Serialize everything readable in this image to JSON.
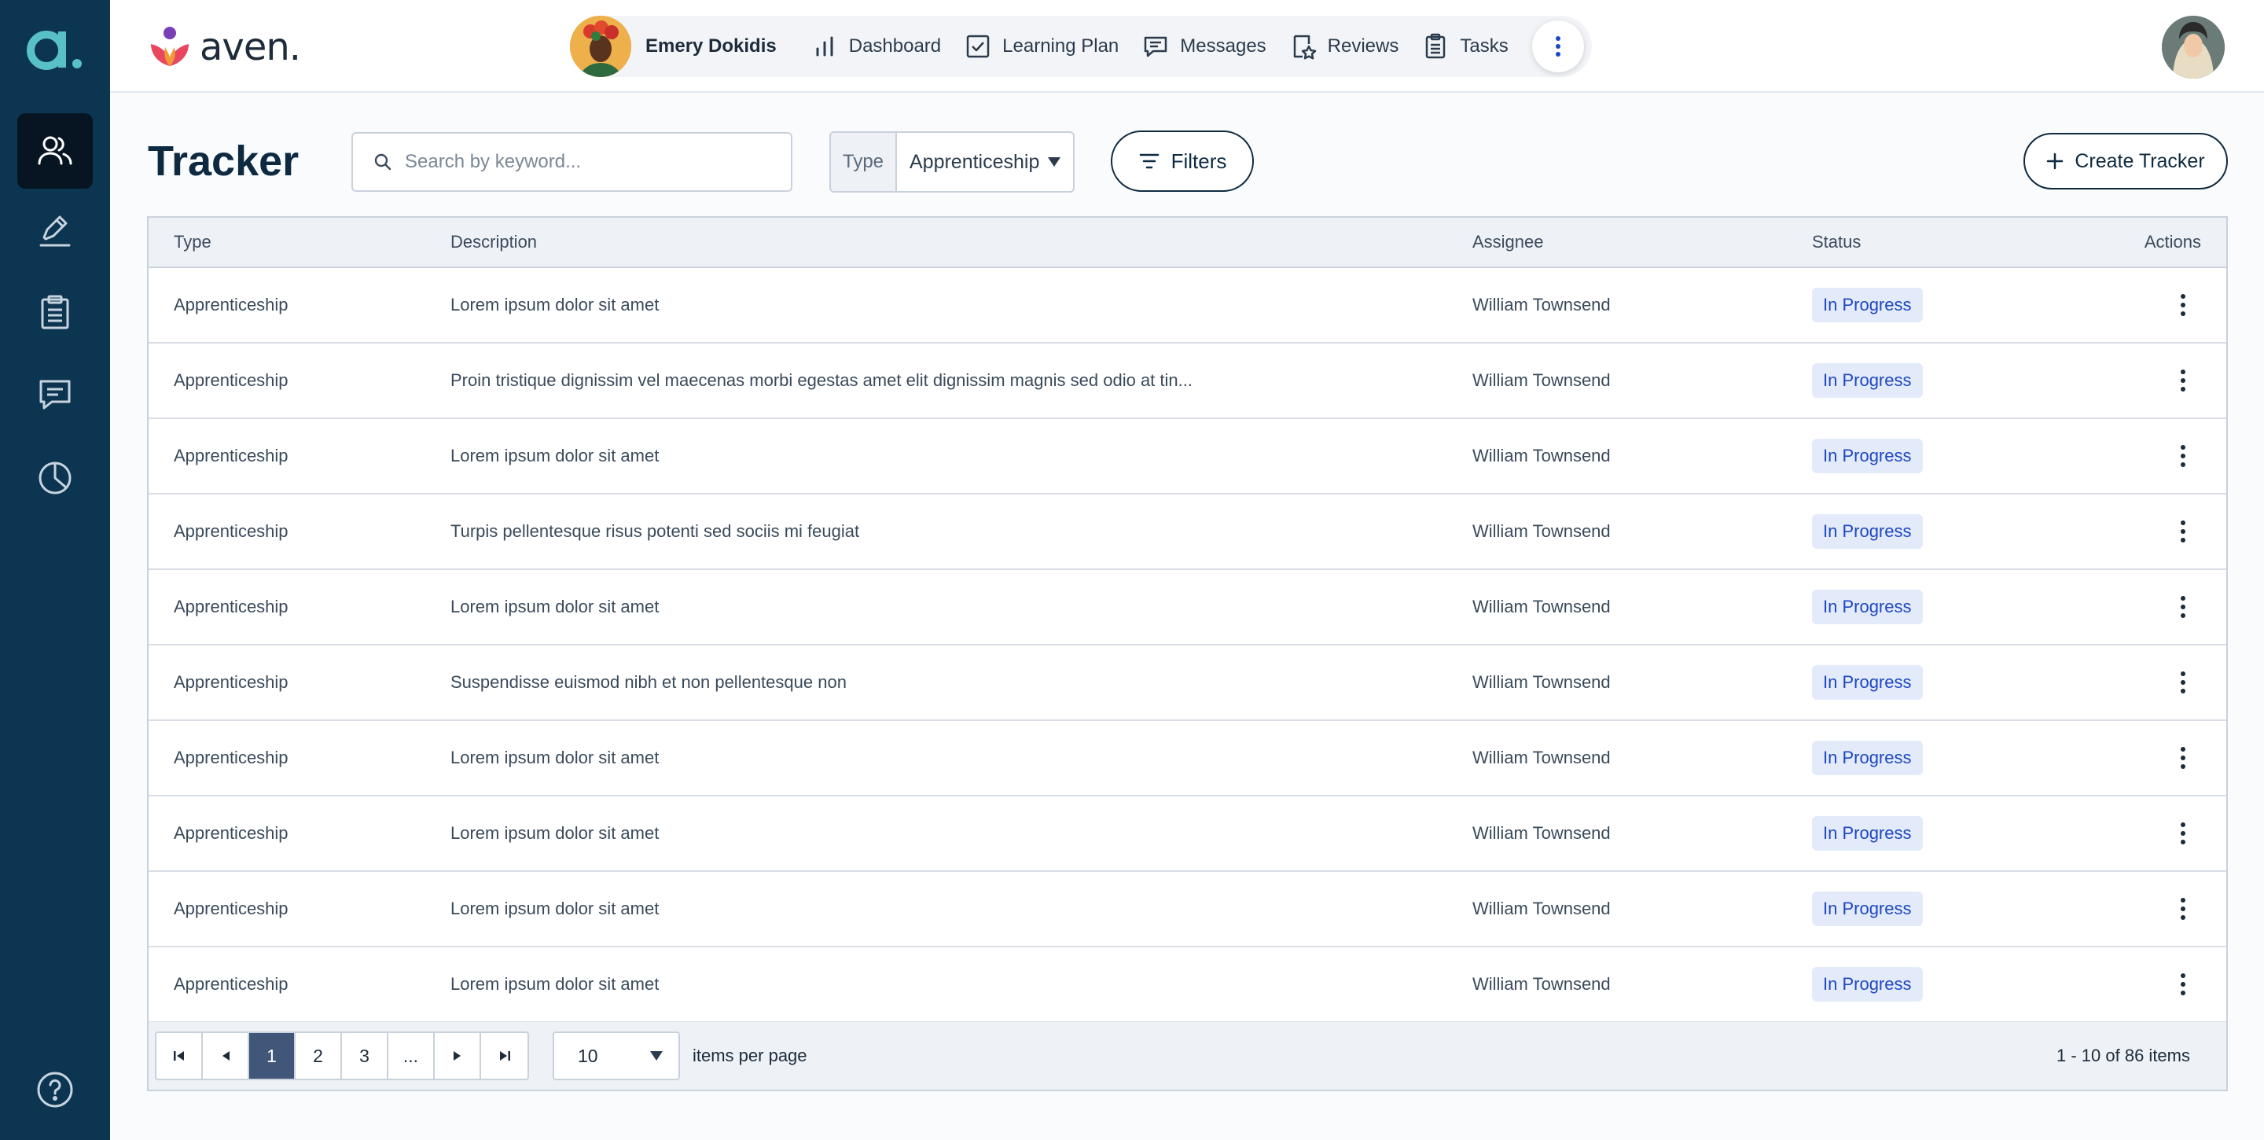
{
  "colors": {
    "rail_bg": "#0c3552",
    "rail_active": "#071522",
    "accent_teal": "#58c0c8",
    "badge_bg": "#e3ebfb",
    "badge_text": "#1e47c2",
    "pager_active": "#41577a"
  },
  "rail": {
    "logo": "a.",
    "items": [
      {
        "icon": "users-icon",
        "active": true
      },
      {
        "icon": "pen-icon",
        "active": false
      },
      {
        "icon": "clipboard-icon",
        "active": false
      },
      {
        "icon": "chat-icon",
        "active": false
      },
      {
        "icon": "pie-chart-icon",
        "active": false
      }
    ],
    "help_icon": "help-icon"
  },
  "brand": {
    "name": "aven."
  },
  "topnav": {
    "profile_name": "Emery Dokidis",
    "items": [
      {
        "label": "Dashboard",
        "icon": "bar-chart-icon"
      },
      {
        "label": "Learning Plan",
        "icon": "checkbox-icon"
      },
      {
        "label": "Messages",
        "icon": "message-icon"
      },
      {
        "label": "Reviews",
        "icon": "review-icon"
      },
      {
        "label": "Tasks",
        "icon": "tasks-icon"
      }
    ],
    "more_icon": "more-vertical-icon"
  },
  "page": {
    "title": "Tracker",
    "search_placeholder": "Search by keyword...",
    "type_label": "Type",
    "type_value": "Apprenticeship",
    "filters_label": "Filters",
    "create_label": "Create Tracker"
  },
  "table": {
    "headers": {
      "type": "Type",
      "description": "Description",
      "assignee": "Assignee",
      "status": "Status",
      "actions": "Actions"
    },
    "rows": [
      {
        "type": "Apprenticeship",
        "description": "Lorem ipsum dolor sit amet",
        "assignee": "William Townsend",
        "status": "In Progress"
      },
      {
        "type": "Apprenticeship",
        "description": "Proin tristique dignissim vel maecenas morbi egestas amet elit dignissim magnis sed odio at tin...",
        "assignee": "William Townsend",
        "status": "In Progress"
      },
      {
        "type": "Apprenticeship",
        "description": "Lorem ipsum dolor sit amet",
        "assignee": "William Townsend",
        "status": "In Progress"
      },
      {
        "type": "Apprenticeship",
        "description": "Turpis pellentesque risus potenti sed sociis mi feugiat",
        "assignee": "William Townsend",
        "status": "In Progress"
      },
      {
        "type": "Apprenticeship",
        "description": "Lorem ipsum dolor sit amet",
        "assignee": "William Townsend",
        "status": "In Progress"
      },
      {
        "type": "Apprenticeship",
        "description": "Suspendisse euismod nibh et non pellentesque non",
        "assignee": "William Townsend",
        "status": "In Progress"
      },
      {
        "type": "Apprenticeship",
        "description": "Lorem ipsum dolor sit amet",
        "assignee": "William Townsend",
        "status": "In Progress"
      },
      {
        "type": "Apprenticeship",
        "description": "Lorem ipsum dolor sit amet",
        "assignee": "William Townsend",
        "status": "In Progress"
      },
      {
        "type": "Apprenticeship",
        "description": "Lorem ipsum dolor sit amet",
        "assignee": "William Townsend",
        "status": "In Progress"
      },
      {
        "type": "Apprenticeship",
        "description": "Lorem ipsum dolor sit amet",
        "assignee": "William Townsend",
        "status": "In Progress"
      }
    ]
  },
  "pagination": {
    "pages": [
      "1",
      "2",
      "3",
      "..."
    ],
    "current": "1",
    "per_page": "10",
    "per_page_label": "items per page",
    "range_info": "1 - 10 of 86 items"
  }
}
